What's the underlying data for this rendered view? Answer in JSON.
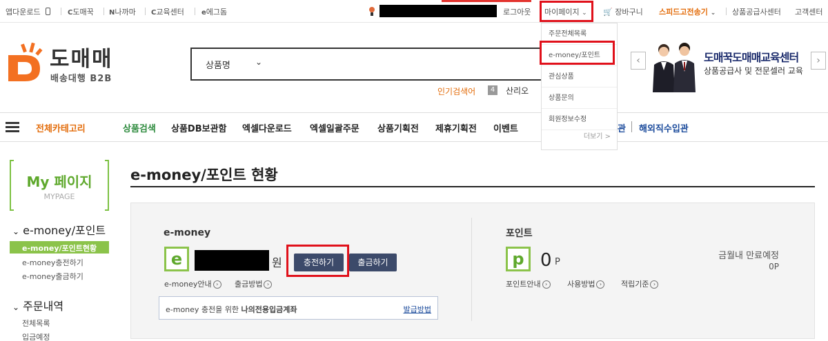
{
  "topbar": {
    "app_download": "앱다운로드",
    "links": [
      "도매꾹",
      "나까마",
      "교육센터",
      "에그돔"
    ],
    "logout": "로그아웃",
    "mypage": "마이페이지",
    "cart": "장바구니",
    "speed": "스피드고전송기",
    "supply_center": "상품공급사센터",
    "customer_center": "고객센터"
  },
  "mypage_dropdown": {
    "items": [
      "주문전체목록",
      "e-money/포인트",
      "관심상품",
      "상품문의",
      "회원정보수정"
    ],
    "more": "더보기 >"
  },
  "header": {
    "logo_title": "도매매",
    "logo_subtitle": "배송대행 B2B",
    "search_select": "상품명",
    "popular_label": "인기검색어",
    "popular_rank": "4",
    "popular_word": "산리오",
    "banner_title": "도매꾹도매매교육센터",
    "banner_sub": "상품공급사 및 전문셀러 교육"
  },
  "nav": {
    "all_category": "전체카테고리",
    "items": [
      "상품검색",
      "상품DB보관함",
      "엑셀다운로드",
      "엑셀일괄주문",
      "상품기획전",
      "제휴기획전",
      "이벤트"
    ],
    "partial_item": "관",
    "overseas": "해외직수입관"
  },
  "sidebar": {
    "mypage_title": "My 페이지",
    "mypage_sub": "MYPAGE",
    "section1_title": "e-money/포인트",
    "section1_items": [
      "e-money/포인트현황",
      "e-money충전하기",
      "e-money출금하기"
    ],
    "section2_title": "주문내역",
    "section2_items": [
      "전체목록",
      "입금예정"
    ]
  },
  "main": {
    "page_title": "e-money/포인트 현황",
    "emoney": {
      "label": "e-money",
      "badge": "e",
      "unit": "원",
      "charge_btn": "충전하기",
      "withdraw_btn": "출금하기",
      "info_link": "e-money안내",
      "withdraw_method": "출금방법",
      "account_text_pre": "e-money 충전을 위한",
      "account_text_bold": "나의전용입금계좌",
      "account_link": "발급방법"
    },
    "point": {
      "label": "포인트",
      "badge": "p",
      "value": "0",
      "unit": "P",
      "info_link": "포인트안내",
      "use_method": "사용방법",
      "accrual": "적립기준",
      "expire_label": "금월내 만료예정",
      "expire_value": "0P"
    }
  }
}
